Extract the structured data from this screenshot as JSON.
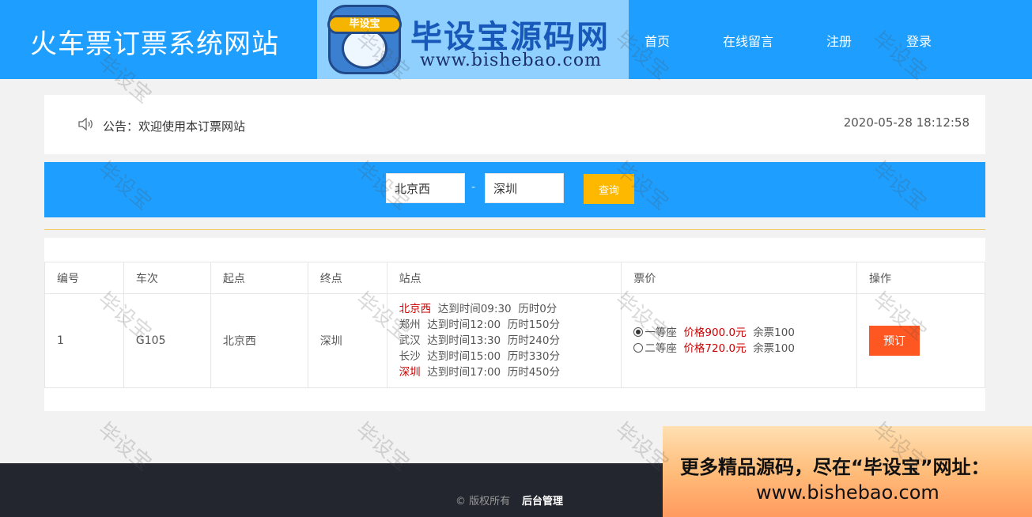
{
  "header": {
    "site_title": "火车票订票系统网站",
    "logo_badge": "毕设宝",
    "logo_main": "毕设宝源码网",
    "logo_url": "www.bishebao.com",
    "nav": [
      "首页",
      "在线留言",
      "注册",
      "登录"
    ]
  },
  "notice": {
    "icon": "speaker-icon",
    "text": "公告：欢迎使用本订票网站",
    "datetime": "2020-05-28 18:12:58"
  },
  "search": {
    "from": "北京西",
    "separator": "-",
    "to": "深圳",
    "button": "查询"
  },
  "table": {
    "columns": [
      "编号",
      "车次",
      "起点",
      "终点",
      "站点",
      "票价",
      "操作"
    ],
    "rows": [
      {
        "id": "1",
        "train": "G105",
        "start": "北京西",
        "end": "深圳",
        "stops": [
          {
            "station": "北京西",
            "arrival": "达到时间09:30",
            "duration": "历时0分"
          },
          {
            "station": "郑州",
            "arrival": "达到时间12:00",
            "duration": "历时150分"
          },
          {
            "station": "武汉",
            "arrival": "达到时间13:30",
            "duration": "历时240分"
          },
          {
            "station": "长沙",
            "arrival": "达到时间15:00",
            "duration": "历时330分"
          },
          {
            "station": "深圳",
            "arrival": "达到时间17:00",
            "duration": "历时450分"
          }
        ],
        "prices": [
          {
            "seat": "一等座",
            "price": "价格900.0元",
            "remaining": "余票100",
            "selected": true
          },
          {
            "seat": "二等座",
            "price": "价格720.0元",
            "remaining": "余票100",
            "selected": false
          }
        ],
        "action": "预订"
      }
    ]
  },
  "footer": {
    "copyright": "© 版权所有",
    "admin_link": "后台管理"
  },
  "promo": {
    "line1": "更多精品源码，尽在“毕设宝”网址：",
    "line2": "www.bishebao.com"
  },
  "watermark": "毕设宝",
  "colors": {
    "primary": "#1e9fff",
    "query_button": "#ffb800",
    "book_button": "#ff5722",
    "footer": "#23262e",
    "highlight_text": "#cc0000"
  }
}
